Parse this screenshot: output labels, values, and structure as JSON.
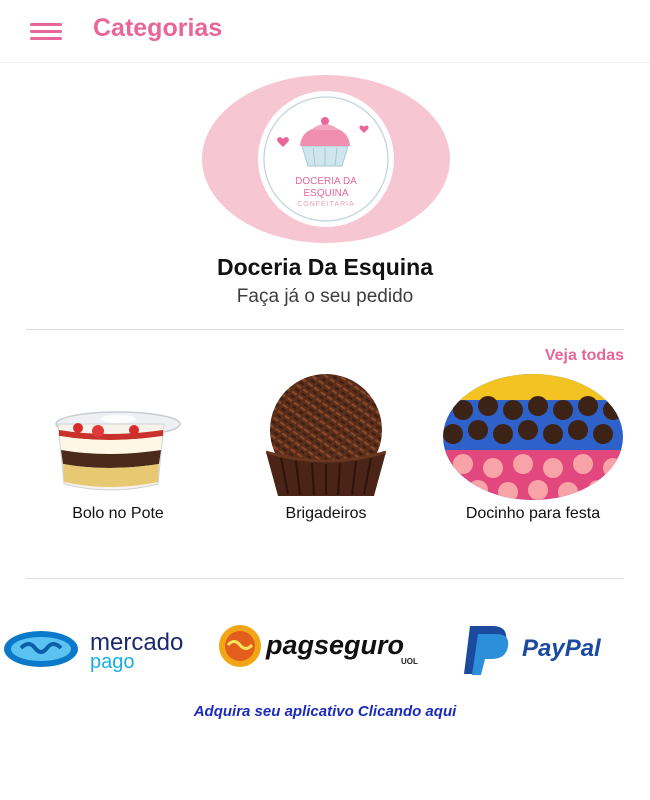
{
  "header": {
    "title": "Categorias",
    "menu_icon": "hamburger-menu-icon"
  },
  "logo": {
    "line1": "DOCERIA DA",
    "line2": "ESQUINA",
    "line3": "CONFEITARIA",
    "colors": {
      "outer": "#f7c6d3",
      "inner": "#ffffff",
      "text": "#e8669a"
    }
  },
  "store": {
    "name": "Doceria Da Esquina",
    "tagline": "Faça já o seu pedido"
  },
  "categories": {
    "see_all_label": "Veja todas",
    "items": [
      {
        "label": "Bolo no Pote"
      },
      {
        "label": "Brigadeiros"
      },
      {
        "label": "Docinho para festa"
      }
    ]
  },
  "payments": {
    "mercadopago_line1": "mercado",
    "mercadopago_line2": "pago",
    "pagseguro_text": "pagseguro",
    "pagseguro_sub": "UOL",
    "paypal_text": "PayPal"
  },
  "cta": {
    "label": "Adquira seu aplicativo Clicando aqui"
  },
  "colors": {
    "accent": "#e8669a",
    "link": "#1c2bb8"
  }
}
